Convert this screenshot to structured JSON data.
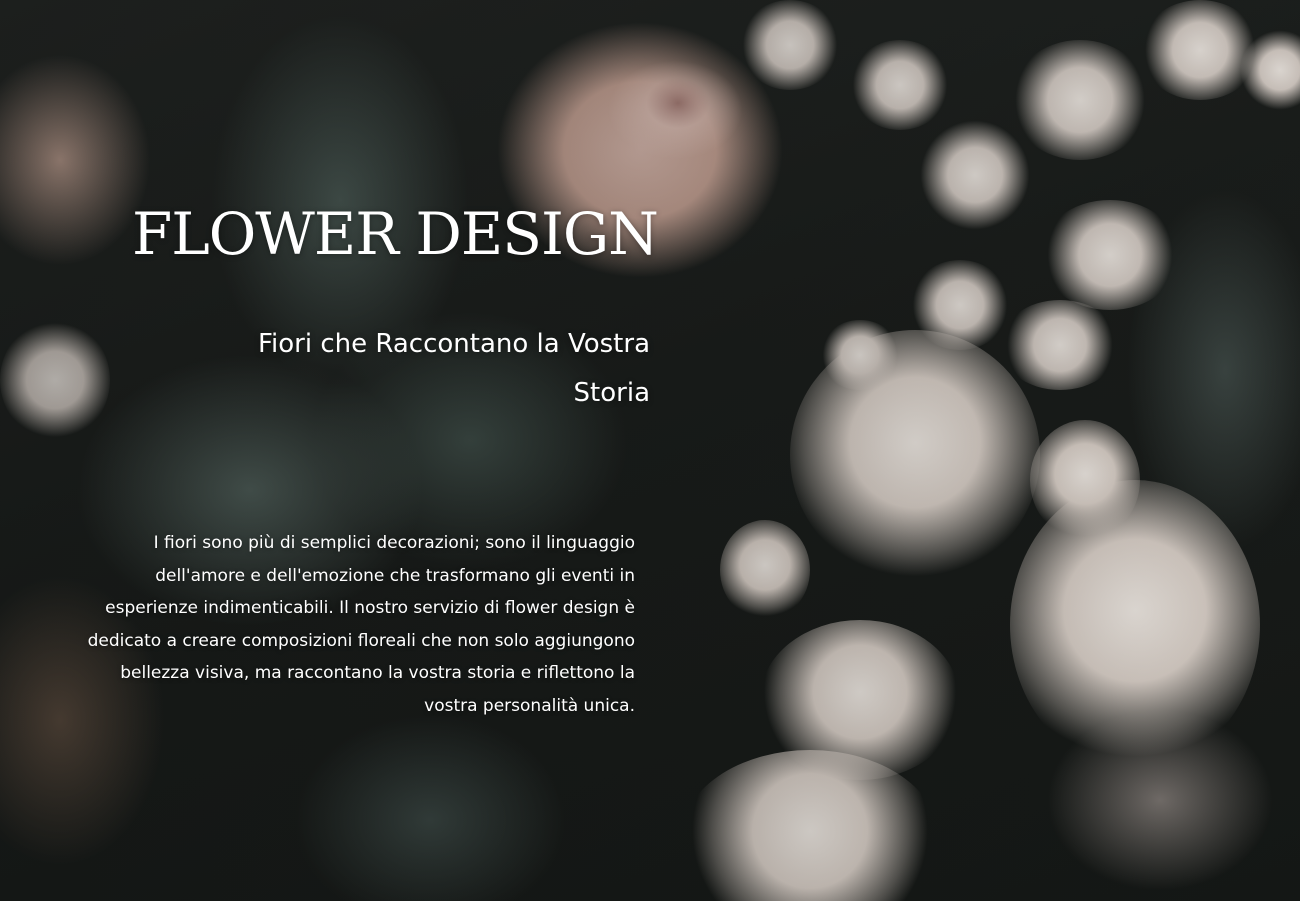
{
  "hero": {
    "title": "FLOWER DESIGN",
    "subtitle": "Fiori che Raccontano la Vostra Storia",
    "body": "I fiori sono più di semplici decorazioni; sono il linguaggio dell'amore e dell'emozione che trasformano gli eventi in esperienze indimenticabili. Il nostro servizio di flower design è dedicato a creare composizioni floreali che non solo aggiungono bellezza visiva, ma raccontano la vostra storia e riflettono la vostra personalità unica."
  },
  "colors": {
    "text": "#ffffff",
    "background": "#1a1d1b"
  }
}
